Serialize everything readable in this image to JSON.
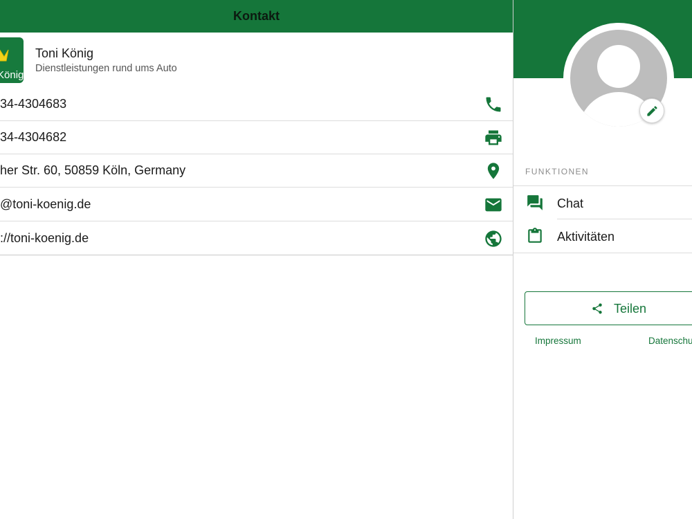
{
  "left_header": {
    "title": "Kontakt"
  },
  "company": {
    "logo_text": "König",
    "name": "Toni König",
    "subtitle": "Dienstleistungen rund ums Auto"
  },
  "contact": {
    "phone": "34-4304683",
    "fax": "34-4304682",
    "address": "her Str. 60, 50859 Köln, Germany",
    "email": "@toni-koenig.de",
    "website": "://toni-koenig.de"
  },
  "icons": {
    "phone": "phone-icon",
    "fax": "printer-icon",
    "address": "map-pin-icon",
    "email": "envelope-icon",
    "website": "globe-icon",
    "chat": "chat-bubbles-icon",
    "activities": "clipboard-icon",
    "share": "share-icon",
    "edit": "pencil-icon"
  },
  "functions": {
    "section_label": "FUNKTIONEN",
    "items": [
      {
        "label": "Chat"
      },
      {
        "label": "Aktivitäten"
      }
    ]
  },
  "share": {
    "label": "Teilen"
  },
  "footer_links": {
    "impressum": "Impressum",
    "datenschutz": "Datenschu"
  },
  "colors": {
    "brand_green": "#15763a",
    "logo_yellow": "#f2d21b"
  }
}
